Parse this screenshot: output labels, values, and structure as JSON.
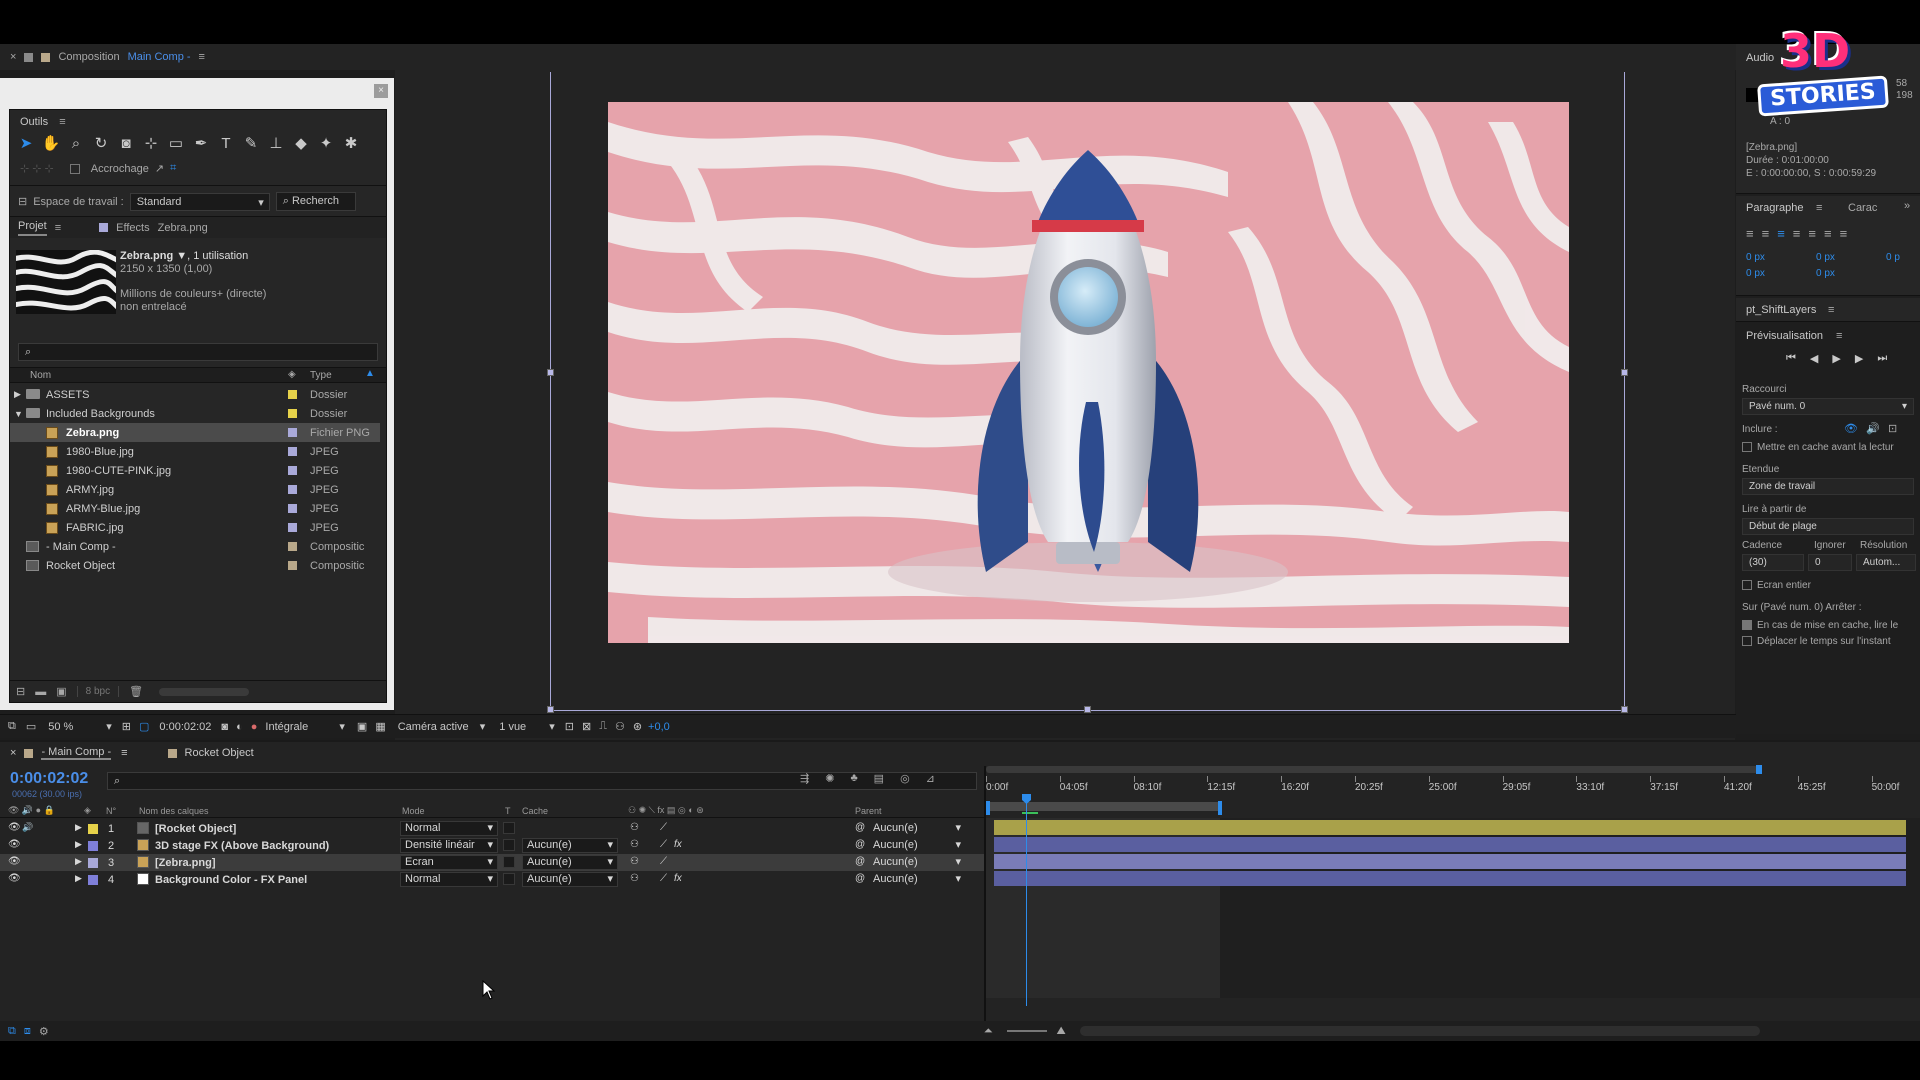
{
  "composition_tab": {
    "close": "×",
    "title": "Composition",
    "name": "Main Comp -",
    "menu": "≡"
  },
  "logo": {
    "line1": "3D",
    "line2": "STORIES"
  },
  "tools_panel": {
    "title": "Outils",
    "snap_label": "Accrochage",
    "workspace_label": "Espace de travail :",
    "workspace_value": "Standard",
    "search_label": "Recherch"
  },
  "project_panel": {
    "tab": "Projet",
    "effects_tab": "Effects",
    "effects_target": "Zebra.png",
    "item_name": "Zebra.png ▼",
    "item_usage": ", 1 utilisation",
    "item_dims": "2150 x 1350 (1,00)",
    "item_colors": "Millions de couleurs+ (directe)",
    "item_interlace": "non entrelacé",
    "search_placeholder": "",
    "col_name": "Nom",
    "col_type": "Type",
    "bpc": "8 bpc",
    "items": [
      {
        "name": "ASSETS",
        "type": "Dossier",
        "kind": "folder",
        "expand": "▶",
        "indent": 0,
        "color": "#e6d24a"
      },
      {
        "name": "Included Backgrounds",
        "type": "Dossier",
        "kind": "folder",
        "expand": "▼",
        "indent": 0,
        "color": "#e6d24a"
      },
      {
        "name": "Zebra.png",
        "type": "Fichier PNG",
        "kind": "image",
        "expand": "",
        "indent": 1,
        "color": "#a9a9d9",
        "selected": true
      },
      {
        "name": "1980-Blue.jpg",
        "type": "JPEG",
        "kind": "image",
        "expand": "",
        "indent": 1,
        "color": "#a9a9d9"
      },
      {
        "name": "1980-CUTE-PINK.jpg",
        "type": "JPEG",
        "kind": "image",
        "expand": "",
        "indent": 1,
        "color": "#a9a9d9"
      },
      {
        "name": "ARMY.jpg",
        "type": "JPEG",
        "kind": "image",
        "expand": "",
        "indent": 1,
        "color": "#a9a9d9"
      },
      {
        "name": "ARMY-Blue.jpg",
        "type": "JPEG",
        "kind": "image",
        "expand": "",
        "indent": 1,
        "color": "#a9a9d9"
      },
      {
        "name": "FABRIC.jpg",
        "type": "JPEG",
        "kind": "image",
        "expand": "",
        "indent": 1,
        "color": "#a9a9d9"
      },
      {
        "name": "- Main Comp -",
        "type": "Compositic",
        "kind": "comp",
        "expand": "",
        "indent": 0,
        "color": "#b9a88a"
      },
      {
        "name": "Rocket Object",
        "type": "Compositic",
        "kind": "comp",
        "expand": "",
        "indent": 0,
        "color": "#b9a88a"
      }
    ]
  },
  "viewer_bar": {
    "zoom": "50 %",
    "timecode": "0:00:02:02",
    "resolution": "Intégrale",
    "camera": "Caméra active",
    "views": "1 vue",
    "exposure": "+0,0"
  },
  "right_panel": {
    "audio": "Audio",
    "num1": "58",
    "num2": "198",
    "a_label": "A : 0",
    "layer_name": "[Zebra.png]",
    "duration": "Durée : 0:01:00:00",
    "inout": "E : 0:00:00:00, S : 0:00:59:29",
    "paragraph_tab": "Paragraphe",
    "char_tab": "Carac",
    "px1": "0 px",
    "px2": "0 px",
    "px3": "0 px",
    "px4": "0 px",
    "px5": "0 p",
    "shift_layers": "pt_ShiftLayers",
    "preview": "Prévisualisation",
    "shortcut_label": "Raccourci",
    "shortcut_value": "Pavé num. 0",
    "include_label": "Inclure :",
    "cache_before": "Mettre en cache avant la lectur",
    "range_label": "Etendue",
    "range_value": "Zone de travail",
    "play_from_label": "Lire à partir de",
    "play_from_value": "Début de plage",
    "rate_label": "Cadence",
    "skip_label": "Ignorer",
    "res_label": "Résolution",
    "rate_value": "(30)",
    "skip_value": "0",
    "res_value": "Autom...",
    "fullscreen": "Ecran entier",
    "stop_label": "Sur (Pavé num. 0) Arrêter :",
    "stop_opt1": "En cas de mise en cache, lire le",
    "stop_opt2": "Déplacer le temps sur l'instant"
  },
  "timeline": {
    "comp_tab": "- Main Comp -",
    "other_tab": "Rocket Object",
    "timecode": "0:00:02:02",
    "frames": "00062 (30.00 ips)",
    "headers": {
      "num": "N°",
      "name": "Nom des calques",
      "mode": "Mode",
      "t": "T",
      "cache": "Cache",
      "parent": "Parent"
    },
    "ruler": [
      "0:00f",
      "04:05f",
      "08:10f",
      "12:15f",
      "16:20f",
      "20:25f",
      "25:00f",
      "29:05f",
      "33:10f",
      "37:15f",
      "41:20f",
      "45:25f",
      "50:00f"
    ],
    "layers": [
      {
        "num": "1",
        "name": "[Rocket Object]",
        "mode": "Normal",
        "cache": "",
        "parent": "Aucun(e)",
        "color": "#e6d24a",
        "icon": "comp",
        "fx": false,
        "bar": "#a9a14a"
      },
      {
        "num": "2",
        "name": "3D stage FX (Above Background)",
        "mode": "Densité linéair",
        "cache": "Aucun(e)",
        "parent": "Aucun(e)",
        "color": "#7f7fd9",
        "icon": "image",
        "fx": true,
        "bar": "#5a5fa0"
      },
      {
        "num": "3",
        "name": "[Zebra.png]",
        "mode": "Ecran",
        "cache": "Aucun(e)",
        "parent": "Aucun(e)",
        "color": "#a9a9d9",
        "icon": "image",
        "fx": false,
        "bar": "#7a7cb8",
        "selected": true
      },
      {
        "num": "4",
        "name": "Background Color - FX Panel",
        "mode": "Normal",
        "cache": "Aucun(e)",
        "parent": "Aucun(e)",
        "color": "#7f7fd9",
        "icon": "solid",
        "fx": true,
        "bar": "#5a5fa0"
      }
    ]
  },
  "colors": {
    "accent": "#2d8ceb",
    "timecode": "#4a8ee8"
  }
}
